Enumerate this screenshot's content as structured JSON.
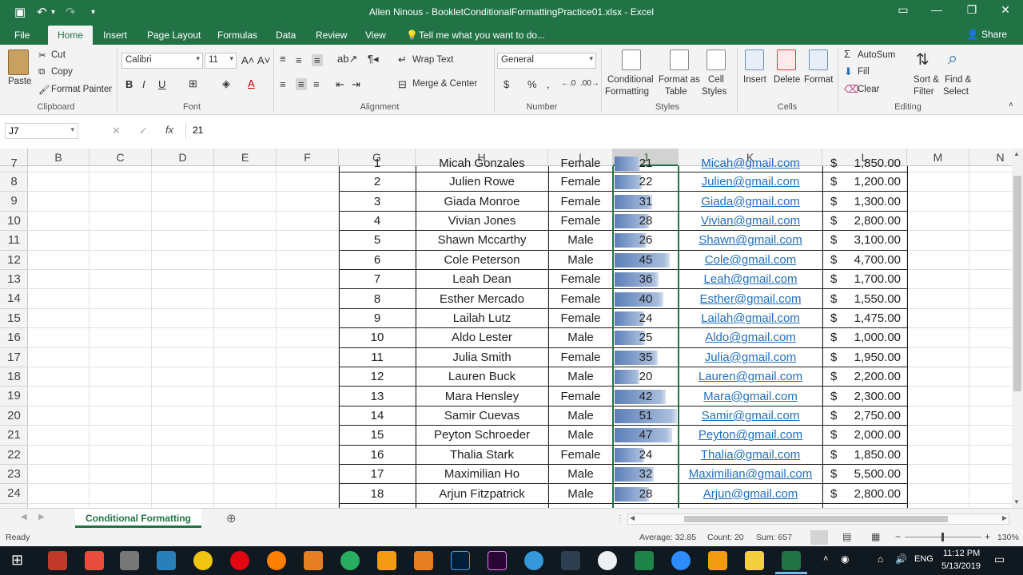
{
  "window": {
    "title": "Allen Ninous - BookletConditionalFormattingPractice01.xlsx - Excel",
    "qat": [
      "💾",
      "↶",
      "↷",
      "▾"
    ]
  },
  "tabs": [
    "File",
    "Home",
    "Insert",
    "Page Layout",
    "Formulas",
    "Data",
    "Review",
    "View"
  ],
  "tell_me": "Tell me what you want to do...",
  "share": "Share",
  "ribbon": {
    "clipboard": {
      "paste": "Paste",
      "cut": "Cut",
      "copy": "Copy",
      "format_painter": "Format Painter",
      "label": "Clipboard"
    },
    "font": {
      "name": "Calibri",
      "size": "11",
      "label": "Font"
    },
    "alignment": {
      "wrap": "Wrap Text",
      "merge": "Merge & Center",
      "label": "Alignment"
    },
    "number": {
      "format": "General",
      "label": "Number"
    },
    "styles": {
      "cond": "Conditional",
      "cond2": "Formatting",
      "fmt_table": "Format as",
      "fmt_table2": "Table",
      "cell_styles": "Cell",
      "cell_styles2": "Styles",
      "label": "Styles"
    },
    "cells": {
      "insert": "Insert",
      "delete": "Delete",
      "format": "Format",
      "label": "Cells"
    },
    "editing": {
      "autosum": "AutoSum",
      "fill": "Fill",
      "clear": "Clear",
      "sort": "Sort &",
      "sort2": "Filter",
      "find": "Find &",
      "find2": "Select",
      "label": "Editing"
    }
  },
  "formula_bar": {
    "name_box": "J7",
    "cancel": "✕",
    "enter": "✓",
    "fx": "fx",
    "formula": "21"
  },
  "columns": [
    "B",
    "C",
    "D",
    "E",
    "F",
    "G",
    "H",
    "I",
    "J",
    "K",
    "L",
    "M",
    "N"
  ],
  "selected_column": "J",
  "top_partial_row": {
    "row": "7",
    "num": "1",
    "name": "Micah Gonzales",
    "gender": "Female",
    "age": "21",
    "email": "Micah@gmail.com",
    "amount": "1,850.00"
  },
  "rows": [
    {
      "row": "8",
      "num": "2",
      "name": "Julien Rowe",
      "gender": "Female",
      "age": 22,
      "email": "Julien@gmail.com",
      "amount": "1,200.00"
    },
    {
      "row": "9",
      "num": "3",
      "name": "Giada Monroe",
      "gender": "Female",
      "age": 31,
      "email": "Giada@gmail.com",
      "amount": "1,300.00"
    },
    {
      "row": "10",
      "num": "4",
      "name": "Vivian Jones",
      "gender": "Female",
      "age": 28,
      "email": "Vivian@gmail.com",
      "amount": "2,800.00"
    },
    {
      "row": "11",
      "num": "5",
      "name": "Shawn Mccarthy",
      "gender": "Male",
      "age": 26,
      "email": "Shawn@gmail.com",
      "amount": "3,100.00"
    },
    {
      "row": "12",
      "num": "6",
      "name": "Cole Peterson",
      "gender": "Male",
      "age": 45,
      "email": "Cole@gmail.com",
      "amount": "4,700.00"
    },
    {
      "row": "13",
      "num": "7",
      "name": "Leah Dean",
      "gender": "Female",
      "age": 36,
      "email": "Leah@gmail.com",
      "amount": "1,700.00"
    },
    {
      "row": "14",
      "num": "8",
      "name": "Esther Mercado",
      "gender": "Female",
      "age": 40,
      "email": "Esther@gmail.com",
      "amount": "1,550.00"
    },
    {
      "row": "15",
      "num": "9",
      "name": "Lailah Lutz",
      "gender": "Female",
      "age": 24,
      "email": "Lailah@gmail.com",
      "amount": "1,475.00"
    },
    {
      "row": "16",
      "num": "10",
      "name": "Aldo Lester",
      "gender": "Male",
      "age": 25,
      "email": "Aldo@gmail.com",
      "amount": "1,000.00"
    },
    {
      "row": "17",
      "num": "11",
      "name": "Julia Smith",
      "gender": "Female",
      "age": 35,
      "email": "Julia@gmail.com",
      "amount": "1,950.00"
    },
    {
      "row": "18",
      "num": "12",
      "name": "Lauren Buck",
      "gender": "Male",
      "age": 20,
      "email": "Lauren@gmail.com",
      "amount": "2,200.00"
    },
    {
      "row": "19",
      "num": "13",
      "name": "Mara Hensley",
      "gender": "Female",
      "age": 42,
      "email": "Mara@gmail.com",
      "amount": "2,300.00"
    },
    {
      "row": "20",
      "num": "14",
      "name": "Samir Cuevas",
      "gender": "Male",
      "age": 51,
      "email": "Samir@gmail.com",
      "amount": "2,750.00"
    },
    {
      "row": "21",
      "num": "15",
      "name": "Peyton Schroeder",
      "gender": "Male",
      "age": 47,
      "email": "Peyton@gmail.com",
      "amount": "2,000.00"
    },
    {
      "row": "22",
      "num": "16",
      "name": "Thalia Stark",
      "gender": "Female",
      "age": 24,
      "email": "Thalia@gmail.com",
      "amount": "1,850.00"
    },
    {
      "row": "23",
      "num": "17",
      "name": "Maximilian Ho",
      "gender": "Male",
      "age": 32,
      "email": "Maximilian@gmail.com",
      "amount": "5,500.00"
    },
    {
      "row": "24",
      "num": "18",
      "name": "Arjun Fitzpatrick",
      "gender": "Male",
      "age": 28,
      "email": "Arjun@gmail.com",
      "amount": "2,800.00"
    }
  ],
  "currency_symbol": "$",
  "databar_max": 51,
  "sheet_tab": "Conditional Formatting",
  "status": {
    "ready": "Ready",
    "average": "Average: 32.85",
    "count": "Count: 20",
    "sum": "Sum: 657",
    "zoom": "130%"
  },
  "taskbar": {
    "time": "11:12 PM",
    "date": "5/13/2019",
    "lang": "ENG"
  },
  "colors": {
    "excel_green": "#217346",
    "link": "#1f6fbf",
    "databar": "#5b7fb8"
  }
}
